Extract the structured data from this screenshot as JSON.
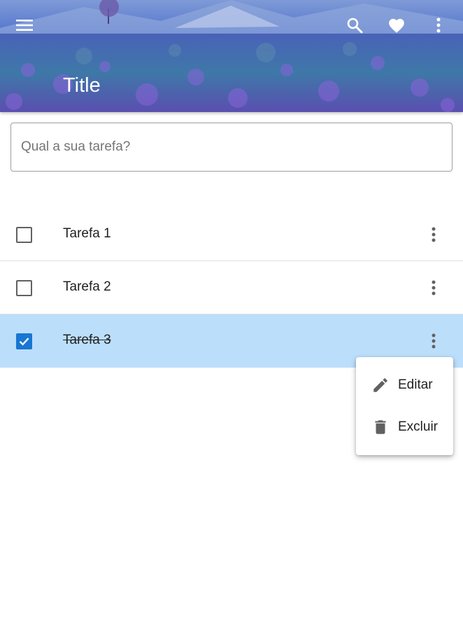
{
  "app_bar": {
    "title": "Title",
    "icons": [
      "menu-icon",
      "search-icon",
      "heart-icon",
      "more-vert-icon"
    ]
  },
  "task_input": {
    "placeholder": "Qual a sua tarefa?",
    "value": ""
  },
  "tasks": [
    {
      "label": "Tarefa 1",
      "checked": false
    },
    {
      "label": "Tarefa 2",
      "checked": false
    },
    {
      "label": "Tarefa 3",
      "checked": true
    }
  ],
  "context_menu": {
    "items": [
      {
        "label": "Editar",
        "icon": "edit-pencil-icon"
      },
      {
        "label": "Excluir",
        "icon": "delete-trash-icon"
      }
    ]
  },
  "colors": {
    "accent": "#1976d2",
    "selected_row": "#bbdefb",
    "header_overlay": "#3f6fc8"
  }
}
